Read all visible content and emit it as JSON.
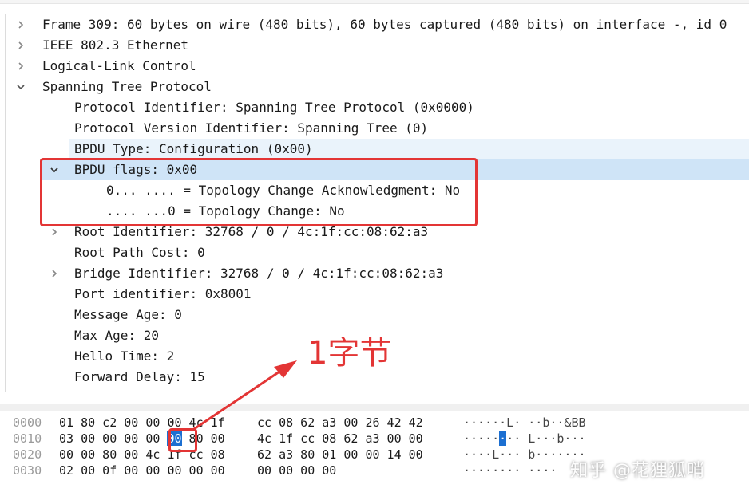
{
  "tree": {
    "rows": [
      {
        "text": "Frame 309: 60 bytes on wire (480 bits), 60 bytes captured (480 bits) on interface -, id 0",
        "expander": "collapsed"
      },
      {
        "text": "IEEE 802.3 Ethernet",
        "expander": "collapsed"
      },
      {
        "text": "Logical-Link Control",
        "expander": "collapsed"
      },
      {
        "text": "Spanning Tree Protocol",
        "expander": "expanded"
      },
      {
        "text": "Protocol Identifier: Spanning Tree Protocol (0x0000)",
        "expander": "none"
      },
      {
        "text": "Protocol Version Identifier: Spanning Tree (0)",
        "expander": "none"
      },
      {
        "text": "BPDU Type: Configuration (0x00)",
        "expander": "none"
      },
      {
        "text": "BPDU flags: 0x00",
        "expander": "expanded"
      },
      {
        "text": "0... .... = Topology Change Acknowledgment: No",
        "expander": "none"
      },
      {
        "text": ".... ...0 = Topology Change: No",
        "expander": "none"
      },
      {
        "text": "Root Identifier: 32768 / 0 / 4c:1f:cc:08:62:a3",
        "expander": "collapsed"
      },
      {
        "text": "Root Path Cost: 0",
        "expander": "none"
      },
      {
        "text": "Bridge Identifier: 32768 / 0 / 4c:1f:cc:08:62:a3",
        "expander": "collapsed"
      },
      {
        "text": "Port identifier: 0x8001",
        "expander": "none"
      },
      {
        "text": "Message Age: 0",
        "expander": "none"
      },
      {
        "text": "Max Age: 20",
        "expander": "none"
      },
      {
        "text": "Hello Time: 2",
        "expander": "none"
      },
      {
        "text": "Forward Delay: 15",
        "expander": "none"
      }
    ]
  },
  "hex": {
    "rows": [
      {
        "offset": "0000",
        "bytes_a": "01 80 c2 00 00 00 4c 1f",
        "bytes_b": "cc 08 62 a3 00 26 42 42",
        "ascii": "······L· ··b··&BB"
      },
      {
        "offset": "0010",
        "bytes_a": "03 00 00 00 00 ",
        "highlight_byte": "00",
        "bytes_a_rest": " 80 00",
        "bytes_b": "4c 1f cc 08 62 a3 00 00",
        "ascii_pre": "·····",
        "ascii_hl": "·",
        "ascii_post": "·· L···b···"
      },
      {
        "offset": "0020",
        "bytes_a": "00 00 80 00 4c 1f cc 08",
        "bytes_b": "62 a3 80 01 00 00 14 00",
        "ascii": "····L··· b·······"
      },
      {
        "offset": "0030",
        "bytes_a": "02 00 0f 00 00 00 00 00",
        "bytes_b": "00 00 00 00",
        "ascii": "········ ····"
      }
    ]
  },
  "annotation": {
    "label": "1字节",
    "color": "#e33535"
  },
  "watermark": "知乎 @花狸狐哨",
  "colors": {
    "selected_row": "#cfe4f7",
    "alt_row": "#eaf3fb",
    "hex_highlight": "#1c6fd1"
  }
}
